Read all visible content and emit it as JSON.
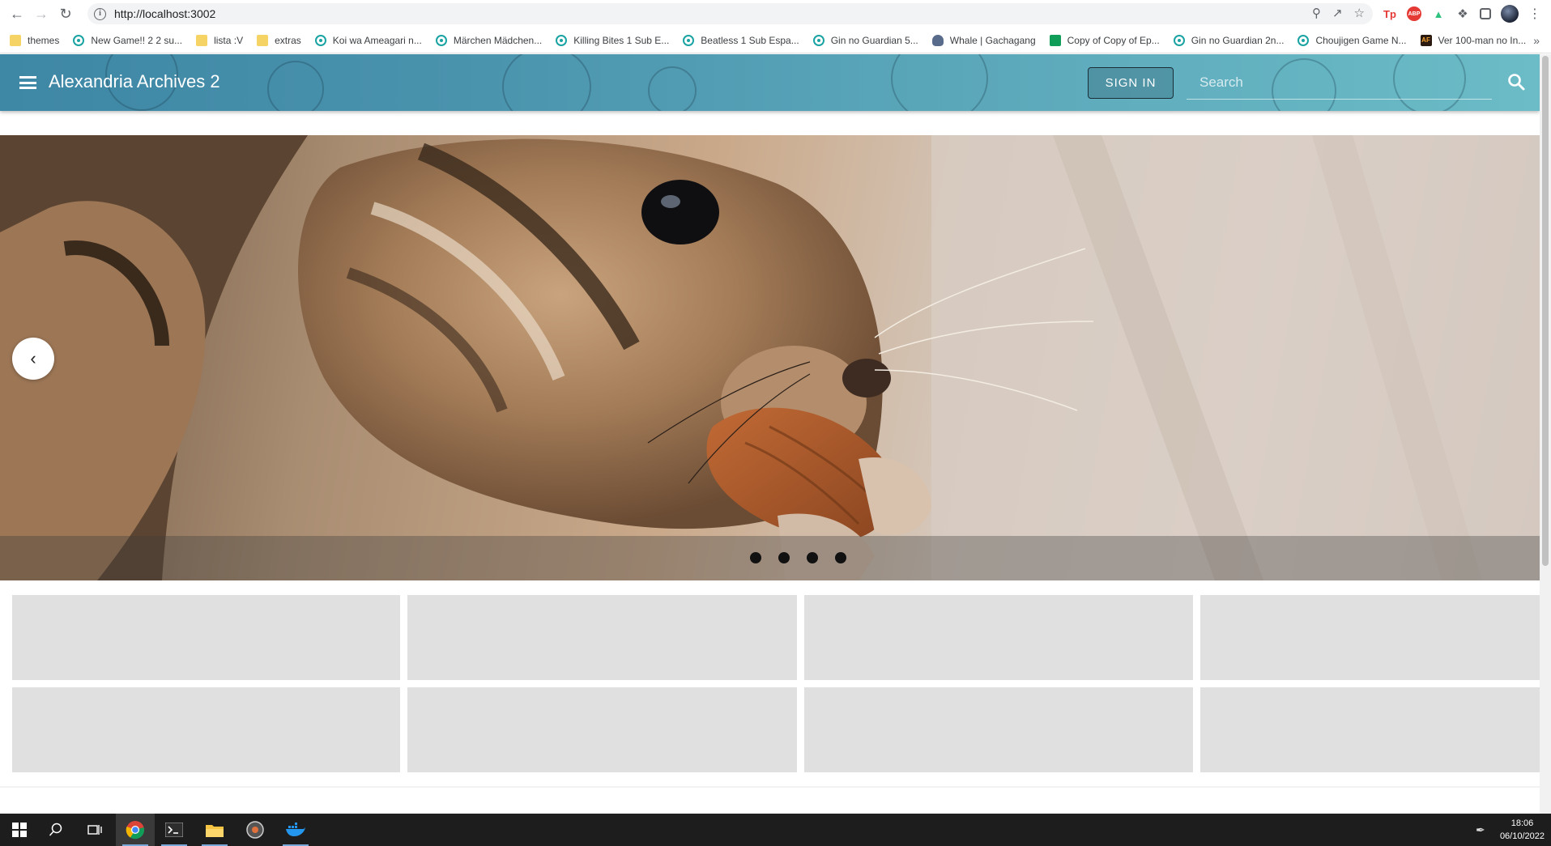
{
  "browser": {
    "url": "http://localhost:3002",
    "bookmarks": [
      {
        "label": "themes",
        "icon": "folder-icon"
      },
      {
        "label": "New Game!! 2 2 su...",
        "icon": "ring-icon"
      },
      {
        "label": "lista :V",
        "icon": "folder-icon"
      },
      {
        "label": "extras",
        "icon": "folder-icon"
      },
      {
        "label": "Koi wa Ameagari n...",
        "icon": "ring-icon"
      },
      {
        "label": "Märchen Mädchen...",
        "icon": "ring-icon"
      },
      {
        "label": "Killing Bites 1 Sub E...",
        "icon": "ring-icon"
      },
      {
        "label": "Beatless 1 Sub Espa...",
        "icon": "ring-icon"
      },
      {
        "label": "Gin no Guardian 5...",
        "icon": "ring-icon"
      },
      {
        "label": "Whale | Gachagang",
        "icon": "whale-icon"
      },
      {
        "label": "Copy of Copy of Ep...",
        "icon": "sheet-icon"
      },
      {
        "label": "Gin no Guardian 2n...",
        "icon": "ring-icon"
      },
      {
        "label": "Choujigen Game N...",
        "icon": "ring-icon"
      },
      {
        "label": "Ver 100-man no In...",
        "icon": "af-icon"
      }
    ],
    "more": "»",
    "extensions": [
      {
        "label": "Tp",
        "color": "#e53935"
      },
      {
        "label": "ABP",
        "color": "#e53935"
      },
      {
        "label": "▲",
        "color": "#2ec27e"
      }
    ]
  },
  "app": {
    "title": "Alexandria Archives 2",
    "signin_label": "SIGN IN",
    "search_placeholder": "Search"
  },
  "carousel": {
    "prev_glyph": "‹",
    "slide_count": 4,
    "image": "chipmunk eating an almond"
  },
  "grid": {
    "cards": 8
  },
  "taskbar": {
    "time": "18:06",
    "date": "06/10/2022"
  }
}
